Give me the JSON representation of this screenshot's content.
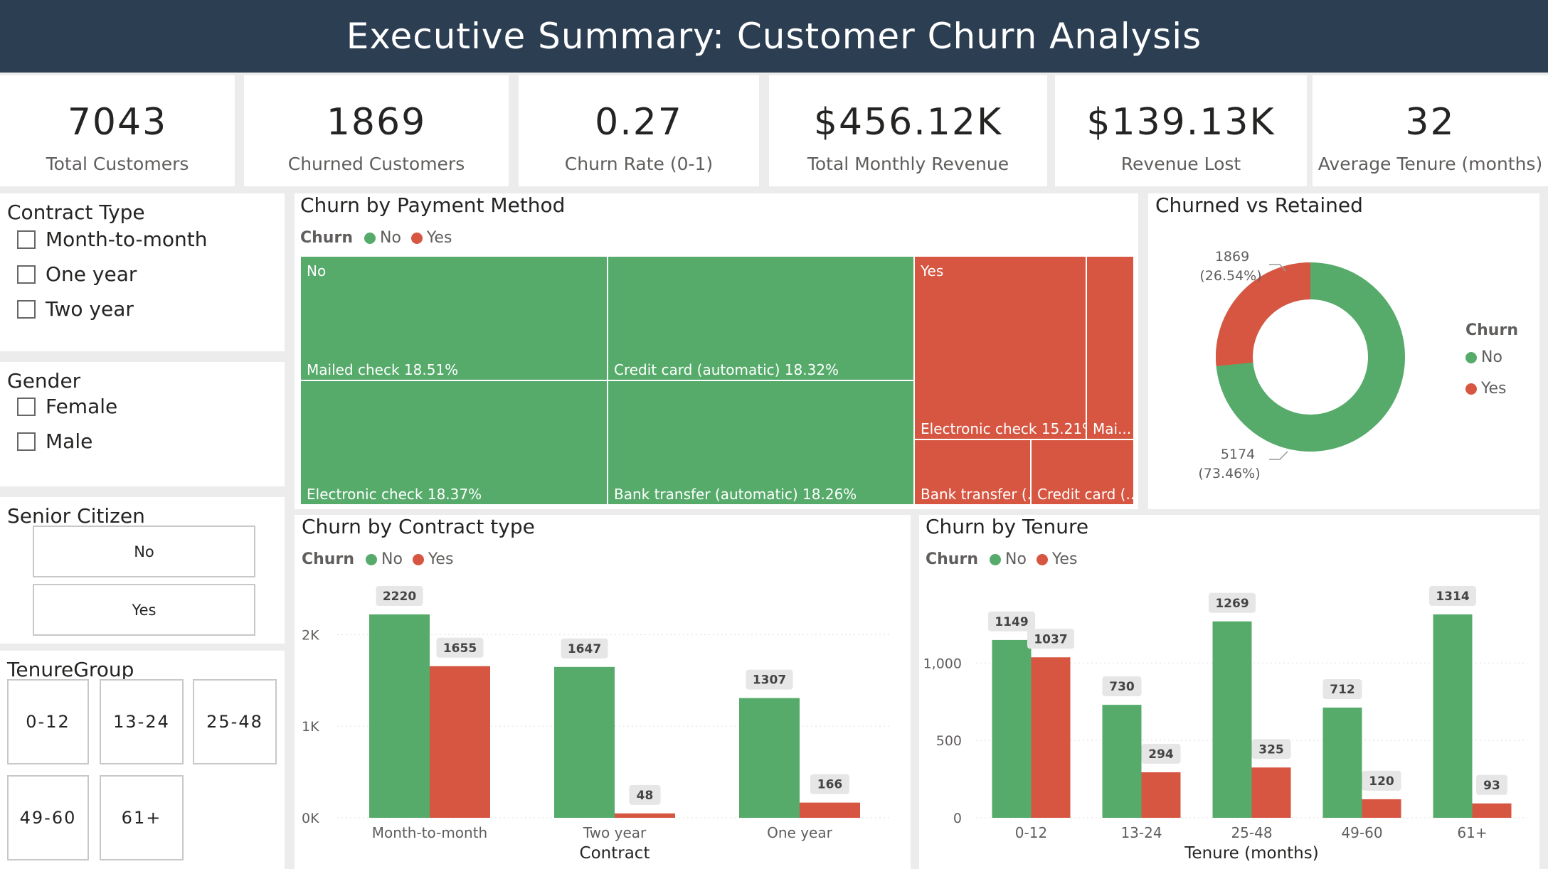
{
  "header": {
    "title": "Executive Summary: Customer Churn Analysis"
  },
  "colors": {
    "no": "#56ab6b",
    "yes": "#d75642",
    "header_bg": "#2c3e52"
  },
  "kpis": [
    {
      "value": "7043",
      "label": "Total Customers"
    },
    {
      "value": "1869",
      "label": "Churned Customers"
    },
    {
      "value": "0.27",
      "label": "Churn Rate (0-1)"
    },
    {
      "value": "$456.12K",
      "label": "Total Monthly Revenue"
    },
    {
      "value": "$139.13K",
      "label": "Revenue Lost"
    },
    {
      "value": "32",
      "label": "Average Tenure (months)"
    }
  ],
  "slicers": {
    "contract": {
      "title": "Contract Type",
      "options": [
        "Month-to-month",
        "One year",
        "Two year"
      ]
    },
    "gender": {
      "title": "Gender",
      "options": [
        "Female",
        "Male"
      ]
    },
    "senior": {
      "title": "Senior Citizen",
      "options": [
        "No",
        "Yes"
      ]
    },
    "tenure": {
      "title": "TenureGroup",
      "options": [
        "0-12",
        "13-24",
        "25-48",
        "49-60",
        "61+"
      ]
    }
  },
  "legend": {
    "title": "Churn",
    "no": "No",
    "yes": "Yes"
  },
  "treemap": {
    "title": "Churn by Payment Method",
    "group_no": "No",
    "group_yes": "Yes",
    "cells": [
      {
        "label": "Mailed check 18.51%",
        "group": "no"
      },
      {
        "label": "Credit card (automatic) 18.32%",
        "group": "no"
      },
      {
        "label": "Electronic check 18.37%",
        "group": "no"
      },
      {
        "label": "Bank transfer (automatic) 18.26%",
        "group": "no"
      },
      {
        "label": "Electronic check 15.21%",
        "group": "yes"
      },
      {
        "label": "Mai...",
        "group": "yes"
      },
      {
        "label": "Bank transfer (...",
        "group": "yes"
      },
      {
        "label": "Credit card (...",
        "group": "yes"
      }
    ]
  },
  "donut": {
    "title": "Churned vs Retained",
    "yes_value": "1869",
    "yes_pct": "(26.54%)",
    "no_value": "5174",
    "no_pct": "(73.46%)"
  },
  "chart_data": [
    {
      "type": "bar",
      "title": "Churn by Contract type",
      "xlabel": "Contract",
      "ylabel": "",
      "categories": [
        "Month-to-month",
        "Two year",
        "One year"
      ],
      "series": [
        {
          "name": "No",
          "values": [
            2220,
            1647,
            1307
          ]
        },
        {
          "name": "Yes",
          "values": [
            1655,
            48,
            166
          ]
        }
      ],
      "ylim": [
        0,
        2220
      ],
      "yticks": [
        0,
        1000,
        2000
      ],
      "ytick_labels": [
        "0K",
        "1K",
        "2K"
      ],
      "grid": true,
      "legend_position": "top-left"
    },
    {
      "type": "bar",
      "title": "Churn by Tenure",
      "xlabel": "Tenure (months)",
      "ylabel": "",
      "categories": [
        "0-12",
        "13-24",
        "25-48",
        "49-60",
        "61+"
      ],
      "series": [
        {
          "name": "No",
          "values": [
            1149,
            730,
            1269,
            712,
            1314
          ]
        },
        {
          "name": "Yes",
          "values": [
            1037,
            294,
            325,
            120,
            93
          ]
        }
      ],
      "ylim": [
        0,
        1314
      ],
      "yticks": [
        0,
        500,
        1000
      ],
      "ytick_labels": [
        "0",
        "500",
        "1,000"
      ],
      "grid": true,
      "legend_position": "top-left"
    }
  ]
}
